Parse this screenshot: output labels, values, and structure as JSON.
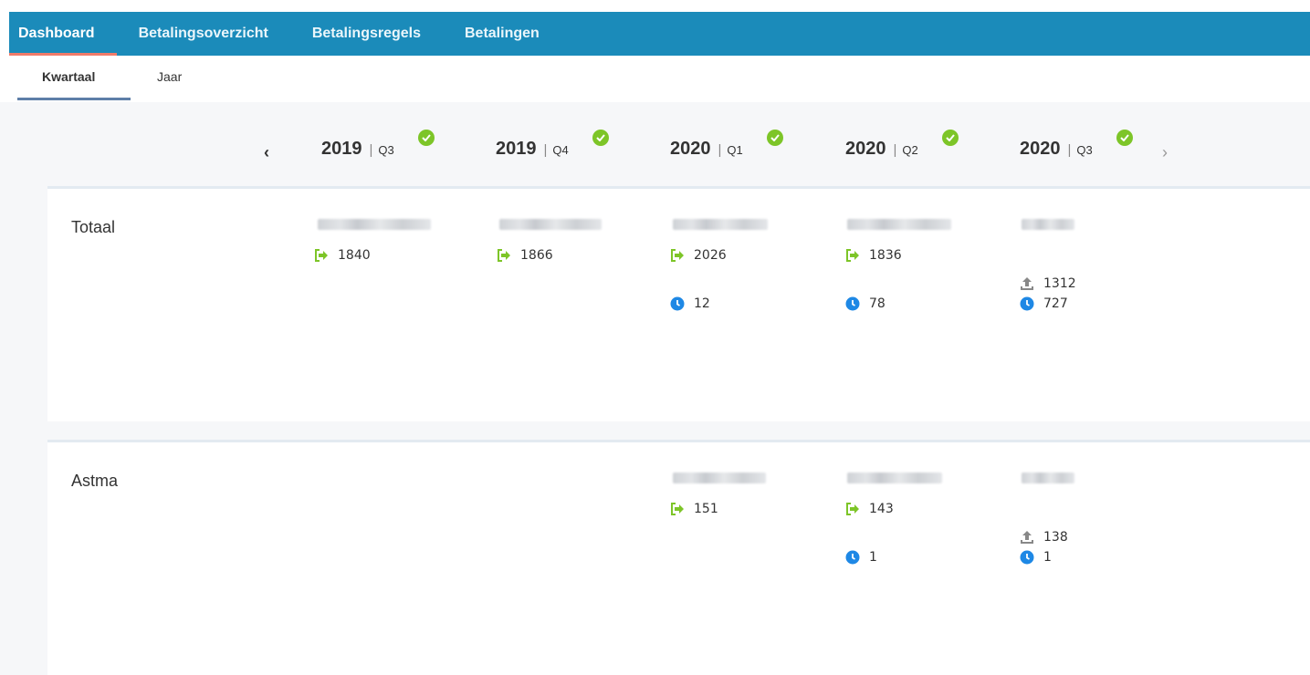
{
  "nav": {
    "tabs": [
      "Dashboard",
      "Betalingsoverzicht",
      "Betalingsregels",
      "Betalingen"
    ],
    "active": 0
  },
  "subnav": {
    "tabs": [
      "Kwartaal",
      "Jaar"
    ],
    "active": 0
  },
  "quarters": [
    {
      "year": "2019",
      "sep": "|",
      "q": "Q3",
      "done": true
    },
    {
      "year": "2019",
      "sep": "|",
      "q": "Q4",
      "done": true
    },
    {
      "year": "2020",
      "sep": "|",
      "q": "Q1",
      "done": true
    },
    {
      "year": "2020",
      "sep": "|",
      "q": "Q2",
      "done": true
    },
    {
      "year": "2020",
      "sep": "|",
      "q": "Q3",
      "done": true
    }
  ],
  "pager": {
    "prev": "‹",
    "next": "›"
  },
  "colors": {
    "nav_bg": "#1b8bba",
    "active_underline": "#f07b6a",
    "green": "#7dc528",
    "blue": "#1e88e5"
  },
  "rows": [
    {
      "title": "Totaal",
      "cells": [
        {
          "sent": "1840"
        },
        {
          "sent": "1866"
        },
        {
          "sent": "2026",
          "pending": "12"
        },
        {
          "sent": "1836",
          "pending": "78"
        },
        {
          "upload": "1312",
          "pending": "727"
        }
      ]
    },
    {
      "title": "Astma",
      "cells": [
        {},
        {},
        {
          "sent": "151"
        },
        {
          "sent": "143",
          "pending": "1"
        },
        {
          "upload": "138",
          "pending": "1"
        }
      ]
    }
  ]
}
